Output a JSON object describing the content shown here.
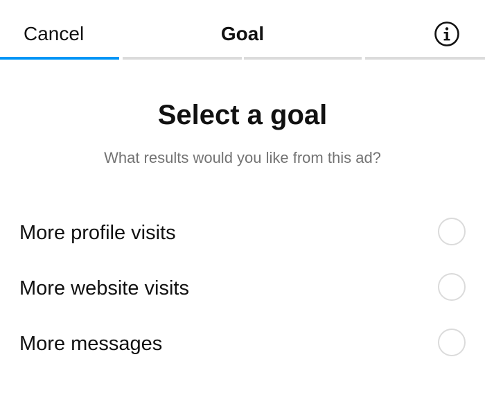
{
  "header": {
    "cancel_label": "Cancel",
    "title": "Goal",
    "info_icon": "info-circle-icon"
  },
  "progress": {
    "total_steps": 4,
    "current_step": 1,
    "active_color": "#0095f6",
    "inactive_color": "#dbdbdb"
  },
  "content": {
    "heading": "Select a goal",
    "subheading": "What results would you like from this ad?"
  },
  "options": [
    {
      "label": "More profile visits",
      "selected": false
    },
    {
      "label": "More website visits",
      "selected": false
    },
    {
      "label": "More messages",
      "selected": false
    }
  ]
}
